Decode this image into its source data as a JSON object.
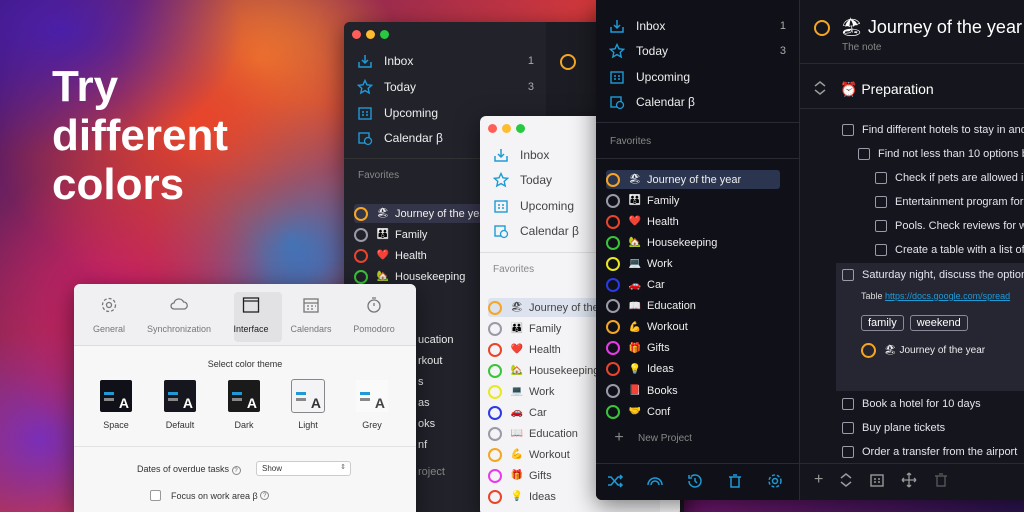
{
  "hero": {
    "line1": "Try",
    "line2": "different",
    "line3": "colors"
  },
  "nav": {
    "inbox": "Inbox",
    "today": "Today",
    "upcoming": "Upcoming",
    "calendar": "Calendar β",
    "inbox_count": "1",
    "today_count": "3"
  },
  "favorites": "Favorites",
  "new_project": "New Project",
  "projects": [
    {
      "emoji": "🏖",
      "name": "Journey of the year",
      "color": "#f5a623"
    },
    {
      "emoji": "👪",
      "name": "Family",
      "color": "#9a9aa8"
    },
    {
      "emoji": "❤️",
      "name": "Health",
      "color": "#e8452b"
    },
    {
      "emoji": "🏡",
      "name": "Housekeeping",
      "color": "#3ac43a"
    },
    {
      "emoji": "💻",
      "name": "Work",
      "color": "#e8e820"
    },
    {
      "emoji": "🚗",
      "name": "Car",
      "color": "#2a3ae8"
    },
    {
      "emoji": "📖",
      "name": "Education",
      "color": "#9a9aa8"
    },
    {
      "emoji": "💪",
      "name": "Workout",
      "color": "#f5a623"
    },
    {
      "emoji": "🎁",
      "name": "Gifts",
      "color": "#e83ae8"
    },
    {
      "emoji": "💡",
      "name": "Ideas",
      "color": "#e8452b"
    },
    {
      "emoji": "📕",
      "name": "Books",
      "color": "#9a9aa8"
    },
    {
      "emoji": "🤝",
      "name": "Conf",
      "color": "#3ac43a"
    }
  ],
  "mid_partial": {
    "work": "rk",
    "education": "ucation",
    "workout": "rkout",
    "s1": "s",
    "s2": "as",
    "ooks": "oks",
    "f": "nf",
    "project": "roject"
  },
  "detail": {
    "title": "🏖 Journey of the year",
    "note": "The note",
    "section": "⏰ Preparation",
    "tasks": [
      "Find different hotels to stay in and",
      "Find not less than 10 options b",
      "Check if pets are allowed in",
      "Entertainment program for",
      "Pools. Check reviews for w",
      "Create a table with a list of",
      "Saturday night, discuss the option"
    ],
    "table_label": "Table",
    "table_link": "https://docs.google.com/spread",
    "tags": [
      "family",
      "weekend"
    ],
    "task_project": "🏖  Journey of the year",
    "tasks2": [
      "Book a hotel for 10 days",
      "Buy plane tickets",
      "Order a transfer from the airport"
    ]
  },
  "settings": {
    "tabs": [
      "General",
      "Synchronization",
      "Interface",
      "Calendars",
      "Pomodoro"
    ],
    "select_theme": "Select color theme",
    "themes": [
      {
        "name": "Space",
        "bg": "#101018",
        "fg": "#fff"
      },
      {
        "name": "Default",
        "bg": "#16161e",
        "fg": "#fff"
      },
      {
        "name": "Dark",
        "bg": "#1a1a1a",
        "fg": "#fff"
      },
      {
        "name": "Light",
        "bg": "#f4f4f6",
        "fg": "#333"
      },
      {
        "name": "Grey",
        "bg": "#fafafa",
        "fg": "#444"
      }
    ],
    "overdue_label": "Dates of overdue tasks",
    "overdue_value": "Show",
    "focus_label": "Focus on work area β"
  },
  "colors": {
    "accent": "#1e9bd7",
    "dark_bg": "#17171f",
    "darker_bg": "#0f0f17"
  }
}
